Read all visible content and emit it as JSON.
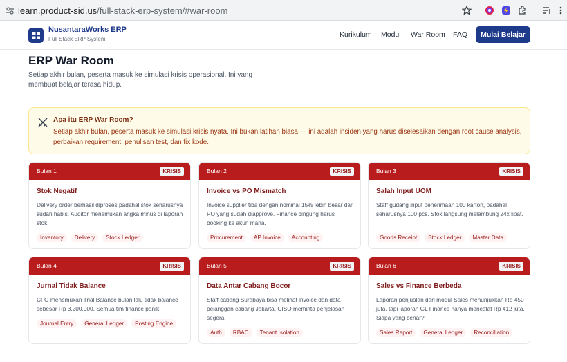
{
  "browser": {
    "url_host": "learn.product-sid.us",
    "url_path": "/full-stack-erp-system/#war-room"
  },
  "header": {
    "brand_name": "NusantaraWorks ERP",
    "brand_sub": "Full Stack ERP System",
    "nav": [
      "Kurikulum",
      "Modul",
      "War Room",
      "FAQ"
    ],
    "cta": "Mulai Belajar"
  },
  "page": {
    "title": "ERP War Room",
    "intro": "Setiap akhir bulan, peserta masuk ke simulasi krisis operasional. Ini yang membuat belajar terasa hidup."
  },
  "info": {
    "title": "Apa itu ERP War Room?",
    "text": "Setiap akhir bulan, peserta masuk ke simulasi krisis nyata. Ini bukan latihan biasa — ini adalah insiden yang harus diselesaikan dengan root cause analysis, perbaikan requirement, penulisan test, dan fix kode."
  },
  "cards": [
    {
      "month": "Bulan 1",
      "badge": "KRISIS",
      "title": "Stok Negatif",
      "desc": "Delivery order berhasil diproses padahal stok seharusnya sudah habis. Auditor menemukan angka minus di laporan stok.",
      "tags": [
        "Inventory",
        "Delivery",
        "Stock Ledger"
      ]
    },
    {
      "month": "Bulan 2",
      "badge": "KRISIS",
      "title": "Invoice vs PO Mismatch",
      "desc": "Invoice supplier tiba dengan nominal 15% lebih besar dari PO yang sudah diapprove. Finance bingung harus booking ke akun mana.",
      "tags": [
        "Procurement",
        "AP Invoice",
        "Accounting"
      ]
    },
    {
      "month": "Bulan 3",
      "badge": "KRISIS",
      "title": "Salah Input UOM",
      "desc": "Staff gudang input penerimaan 100 karton, padahal seharusnya 100 pcs. Stok langsung melambung 24x lipat.",
      "tags": [
        "Goods Receipt",
        "Stock Ledger",
        "Master Data"
      ]
    },
    {
      "month": "Bulan 4",
      "badge": "KRISIS",
      "title": "Jurnal Tidak Balance",
      "desc": "CFO menemukan Trial Balance bulan lalu tidak balance sebesar Rp 3.200.000. Semua tim finance panik.",
      "tags": [
        "Journal Entry",
        "General Ledger",
        "Posting Engine"
      ]
    },
    {
      "month": "Bulan 5",
      "badge": "KRISIS",
      "title": "Data Antar Cabang Bocor",
      "desc": "Staff cabang Surabaya bisa melihat invoice dan data pelanggan cabang Jakarta. CISO meminta penjelasan segera.",
      "tags": [
        "Auth",
        "RBAC",
        "Tenant Isolation"
      ]
    },
    {
      "month": "Bulan 6",
      "badge": "KRISIS",
      "title": "Sales vs Finance Berbeda",
      "desc": "Laporan penjualan dari modul Sales menunjukkan Rp 450 juta, tapi laporan GL Finance hanya mencatat Rp 412 juta. Siapa yang benar?",
      "tags": [
        "Sales Report",
        "General Ledger",
        "Reconciliation"
      ]
    }
  ]
}
